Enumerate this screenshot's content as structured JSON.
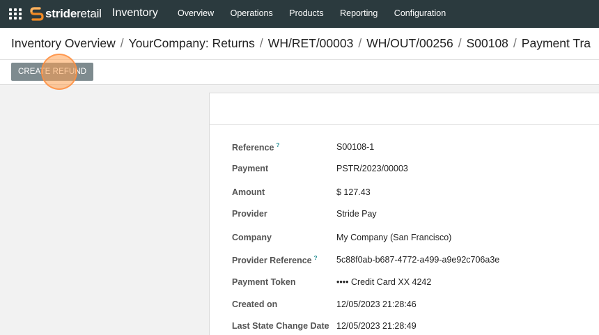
{
  "topbar": {
    "brand_bold": "stride",
    "brand_light": "retail",
    "app_title": "Inventory",
    "menu": [
      "Overview",
      "Operations",
      "Products",
      "Reporting",
      "Configuration"
    ]
  },
  "breadcrumb": [
    "Inventory Overview",
    "YourCompany: Returns",
    "WH/RET/00003",
    "WH/OUT/00256",
    "S00108",
    "Payment Tra"
  ],
  "actions": {
    "create_refund": "CREATE REFUND"
  },
  "fields": [
    {
      "label": "Reference",
      "help": "?",
      "value": "S00108-1"
    },
    {
      "label": "Payment",
      "help": "",
      "value": "PSTR/2023/00003"
    },
    {
      "label": "Amount",
      "help": "",
      "value": "$ 127.43"
    },
    {
      "label": "Provider",
      "help": "",
      "value": "Stride Pay"
    },
    {
      "label": "Company",
      "help": "",
      "value": "My Company (San Francisco)"
    },
    {
      "label": "Provider Reference",
      "help": "?",
      "value": "5c88f0ab-b687-4772-a499-a9e92c706a3e"
    },
    {
      "label": "Payment Token",
      "help": "",
      "value": "•••• Credit Card XX 4242"
    },
    {
      "label": "Created on",
      "help": "",
      "value": "12/05/2023 21:28:46"
    },
    {
      "label": "Last State Change Date",
      "help": "",
      "value": "12/05/2023 21:28:49"
    }
  ],
  "colors": {
    "topbar": "#2b3a3e",
    "button": "#7e8b8f",
    "brand_orange": "#f08a24",
    "help": "#1b8a90"
  },
  "icons": {
    "apps": "grid-apps-icon",
    "brand": "stride-logo-icon"
  }
}
